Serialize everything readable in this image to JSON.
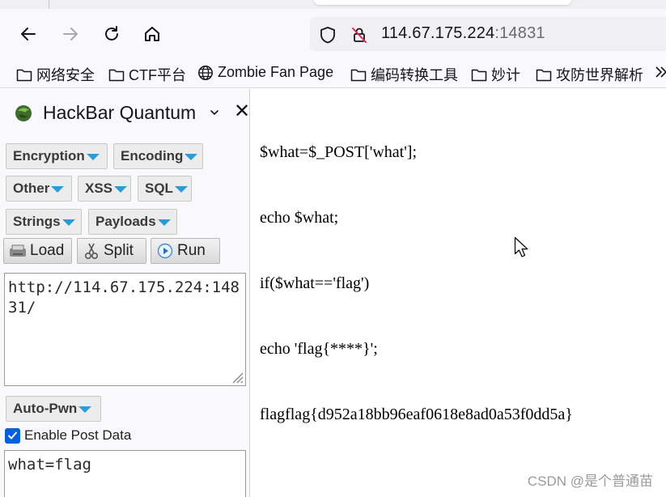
{
  "browser": {
    "url_host": "114.67.175.224",
    "url_port": ":14831",
    "nav_icons": [
      "back-icon",
      "forward-icon",
      "reload-icon",
      "home-icon"
    ],
    "security_icons": [
      "shield-icon",
      "insecure-lock-icon"
    ]
  },
  "bookmarks": [
    {
      "label": "网络安全",
      "icon": "folder-icon"
    },
    {
      "label": "CTF平台",
      "icon": "folder-icon"
    },
    {
      "label": "Zombie Fan Page",
      "icon": "globe-icon"
    },
    {
      "label": "编码转换工具",
      "icon": "folder-icon"
    },
    {
      "label": "妙计",
      "icon": "folder-icon"
    },
    {
      "label": "攻防世界解析",
      "icon": "folder-icon"
    }
  ],
  "sidebar": {
    "title": "HackBar Quantum",
    "close": "✕",
    "menus": {
      "encryption": "Encryption",
      "encoding": "Encoding",
      "other": "Other",
      "xss": "XSS",
      "sql": "SQL",
      "strings": "Strings",
      "payloads": "Payloads"
    },
    "actions": {
      "load": "Load",
      "split": "Split",
      "run": "Run"
    },
    "url_value": "http://114.67.175.224:14831/",
    "autopwn": "Auto-Pwn",
    "enable_post_label": "Enable Post Data",
    "enable_post_checked": true,
    "post_value": "what=flag"
  },
  "page": {
    "lines": [
      "$what=$_POST['what'];",
      "echo $what;",
      "if($what=='flag')",
      "echo 'flag{****}';",
      "flagflag{d952a18bb96eaf0618e8ad0a53f0dd5a}"
    ],
    "watermark": "CSDN @是个普通苗"
  },
  "colors": {
    "accent_blue": "#0060df",
    "dropdown_arrow": "#2b9bd9"
  }
}
